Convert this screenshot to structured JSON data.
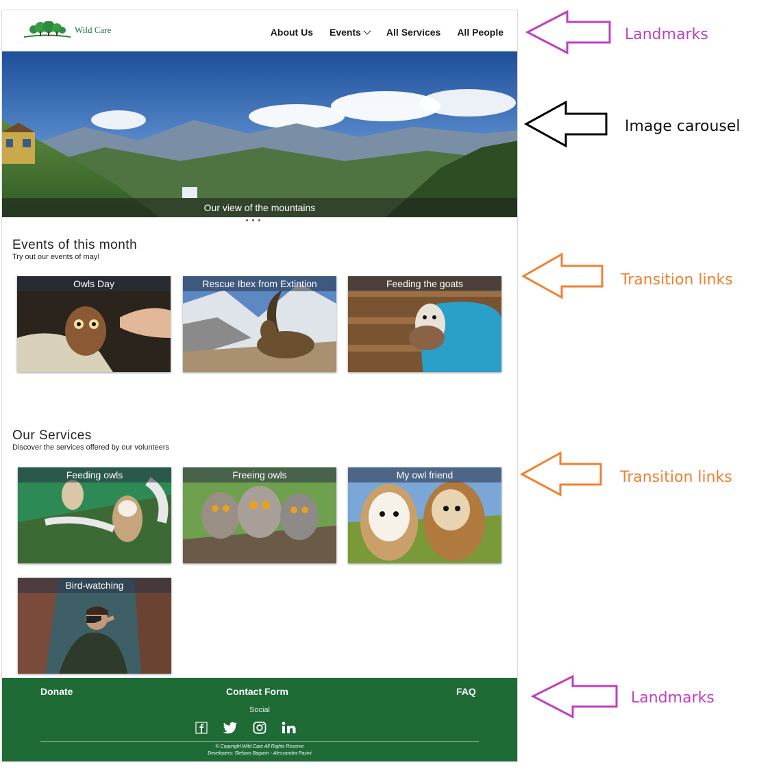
{
  "header": {
    "logo_text": "Wild Care",
    "nav": [
      {
        "label": "About Us"
      },
      {
        "label": "Events"
      },
      {
        "label": "All Services"
      },
      {
        "label": "All People"
      }
    ]
  },
  "carousel": {
    "caption": "Our view of the mountains"
  },
  "events": {
    "title": "Events of this month",
    "subtitle": "Try out our events of may!",
    "cards": [
      {
        "label": "Owls Day"
      },
      {
        "label": "Rescue Ibex from Extintion"
      },
      {
        "label": "Feeding the goats"
      }
    ]
  },
  "services": {
    "title": "Our Services",
    "subtitle": "Discover the services offered by our volunteers",
    "cards": [
      {
        "label": "Feeding owls"
      },
      {
        "label": "Freeing owls"
      },
      {
        "label": "My owl friend"
      },
      {
        "label": "Bird-watching"
      }
    ]
  },
  "footer": {
    "donate": "Donate",
    "contact": "Contact Form",
    "faq": "FAQ",
    "social_label": "Social",
    "social_icons": [
      "facebook-icon",
      "twitter-icon",
      "instagram-icon",
      "linkedin-icon"
    ],
    "copyright": "© Copyright Wild Care All Rights Reserve",
    "developers": "Developers: Stefano Bagarin - Alessandra Pasini"
  },
  "annotations": {
    "landmarks_top": "Landmarks",
    "image_carousel": "Image carousel",
    "transition_links_1": "Transition links",
    "transition_links_2": "Transition links",
    "landmarks_bottom": "Landmarks"
  },
  "colors": {
    "footer_bg": "#1e6b36",
    "landmarks": "#c03fc0",
    "carousel_arrow": "#000000",
    "transition": "#f08030"
  }
}
